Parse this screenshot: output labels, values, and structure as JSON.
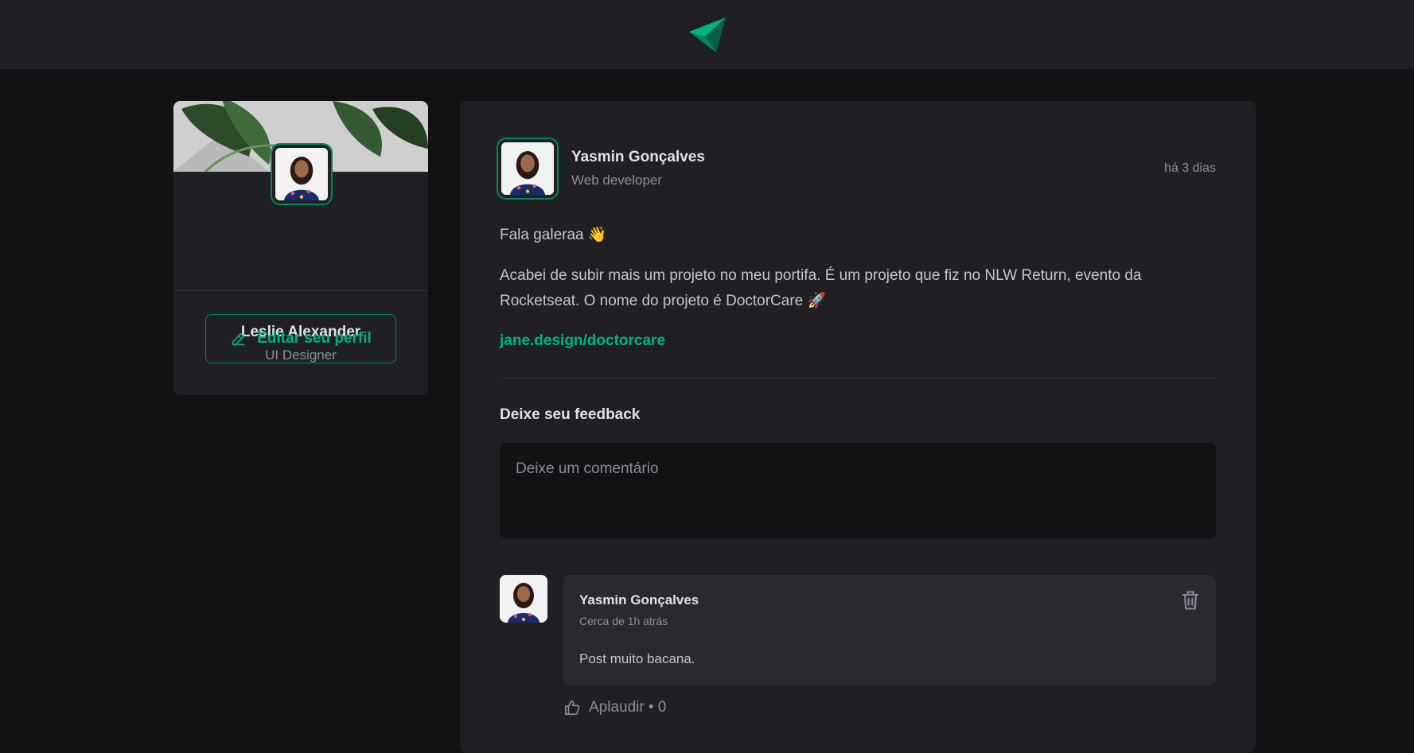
{
  "header": {
    "logo_icon": "paper-plane-logo-icon"
  },
  "colors": {
    "background": "#121214",
    "surface": "#202024",
    "accent": "#00875f",
    "accent_light": "#00b37e"
  },
  "sidebar": {
    "name": "Leslie Alexander",
    "role": "UI Designer",
    "edit_label": "Editar seu perfil",
    "edit_icon": "pencil-icon"
  },
  "post": {
    "author": "Yasmin Gonçalves",
    "role": "Web developer",
    "time": "há 3 dias",
    "greeting": "Fala galeraa 👋",
    "paragraph": "Acabei de subir mais um projeto no meu portifa. É um projeto que fiz no NLW Return, evento da Rocketseat. O nome do projeto é DoctorCare 🚀",
    "link": "jane.design/doctorcare"
  },
  "feedback": {
    "title": "Deixe seu feedback",
    "placeholder": "Deixe um comentário"
  },
  "comments": [
    {
      "author": "Yasmin Gonçalves",
      "time": "Cerca de 1h atrás",
      "text": "Post muito bacana.",
      "applaud_label": "Aplaudir • 0"
    }
  ]
}
